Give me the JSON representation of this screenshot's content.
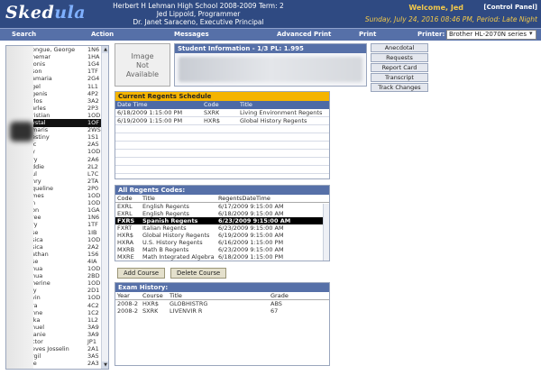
{
  "app": {
    "logo_main": "Sked",
    "logo_rest": "ula",
    "school_line1": "Herbert H Lehman High School 2008-2009 Term: 2",
    "school_line2": "Jed Lippold, Programmer",
    "school_line3": "Dr. Janet Saraceno, Executive Principal",
    "welcome": "Welcome, Jed",
    "control_panel": "[Control Panel]",
    "date_period": "Sunday, July 24, 2016 08:46 PM, Period: Late Night"
  },
  "menu": {
    "search": "Search",
    "action": "Action",
    "messages": "Messages",
    "advanced_print": "Advanced Print",
    "print": "Print",
    "printer_label": "Printer:",
    "printer_value": "Brother HL-2070N series"
  },
  "student_list": [
    {
      "name": "ongue, George",
      "code": "1N6"
    },
    {
      "name": "hemar",
      "code": "1HA"
    },
    {
      "name": "ionis",
      "code": "1G4"
    },
    {
      "name": "son",
      "code": "1TF"
    },
    {
      "name": "amaria",
      "code": "2G4"
    },
    {
      "name": "gel",
      "code": "1L1"
    },
    {
      "name": "genis",
      "code": "4P2"
    },
    {
      "name": "rlos",
      "code": "3A2"
    },
    {
      "name": "arles",
      "code": "2P3"
    },
    {
      "name": "ristian",
      "code": "1OD"
    },
    {
      "name": "ystal",
      "code": "1OF",
      "selected": true
    },
    {
      "name": "maris",
      "code": "2WS"
    },
    {
      "name": "estiny",
      "code": "1S1"
    },
    {
      "name": "ic",
      "code": "2A5"
    },
    {
      "name": "y",
      "code": "1OD"
    },
    {
      "name": "ry",
      "code": "2A6"
    },
    {
      "name": "ddie",
      "code": "2L2"
    },
    {
      "name": "ul",
      "code": "L7C"
    },
    {
      "name": "nry",
      "code": "2TA"
    },
    {
      "name": "queline",
      "code": "2P0"
    },
    {
      "name": "mes",
      "code": "1OD"
    },
    {
      "name": "n",
      "code": "1OD"
    },
    {
      "name": "on",
      "code": "1GA"
    },
    {
      "name": "ree",
      "code": "1N6"
    },
    {
      "name": "ry",
      "code": "1TF"
    },
    {
      "name": "se",
      "code": "1IB"
    },
    {
      "name": "sica",
      "code": "1OD"
    },
    {
      "name": "sica",
      "code": "2A2"
    },
    {
      "name": "athan",
      "code": "1S6"
    },
    {
      "name": "se",
      "code": "4IA"
    },
    {
      "name": "hua",
      "code": "1OD"
    },
    {
      "name": "hua",
      "code": "2BD"
    },
    {
      "name": "herine",
      "code": "1OD"
    },
    {
      "name": "ly",
      "code": "2D1"
    },
    {
      "name": "vin",
      "code": "1OD"
    },
    {
      "name": "ra",
      "code": "4C2"
    },
    {
      "name": "nne",
      "code": "1C2"
    },
    {
      "name": "ika",
      "code": "1L2"
    },
    {
      "name": "huel",
      "code": "3A9"
    },
    {
      "name": "lanie",
      "code": "3A9"
    },
    {
      "name": "ctor",
      "code": "JP1"
    },
    {
      "name": "eves Josselin",
      "code": "2A1"
    },
    {
      "name": "rgil",
      "code": "3A5"
    },
    {
      "name": "ie",
      "code": "2A3"
    }
  ],
  "photo": {
    "text_line1": "Image",
    "text_line2": "Not",
    "text_line3": "Available"
  },
  "student_info": {
    "title": "Student Information - 1/3 PL: 1.995"
  },
  "side_buttons": [
    "Anecdotal",
    "Requests",
    "Report Card",
    "Transcript",
    "Track Changes"
  ],
  "regents_schedule": {
    "title": "Current Regents Schedule",
    "headers": [
      "Date Time",
      "Code",
      "Title"
    ],
    "rows": [
      [
        "6/18/2009 1:15:00 PM",
        "SXRK",
        "Living Environment Regents"
      ],
      [
        "6/19/2009 1:15:00 PM",
        "HXR$",
        "Global History Regents"
      ]
    ]
  },
  "all_regents": {
    "title": "All Regents Codes:",
    "headers": [
      "Code",
      "Title",
      "RegentsDateTime"
    ],
    "rows": [
      [
        "EXRL",
        "English Regents",
        "6/17/2009 9:15:00 AM"
      ],
      [
        "EXRL",
        "English Regents",
        "6/18/2009 9:15:00 AM"
      ],
      [
        "FXRS",
        "Spanish Regents",
        "6/23/2009 9:15:00 AM"
      ],
      [
        "FXRT",
        "Italian Regents",
        "6/23/2009 9:15:00 AM"
      ],
      [
        "HXR$",
        "Global History Regents",
        "6/19/2009 9:15:00 AM"
      ],
      [
        "HXRA",
        "U.S. History Regents",
        "6/16/2009 1:15:00 PM"
      ],
      [
        "MXRB",
        "Math B Regents",
        "6/23/2009 9:15:00 AM"
      ],
      [
        "MXRE",
        "Math Integrated Algebra",
        "6/18/2009 1:15:00 PM"
      ]
    ],
    "selected_index": 2
  },
  "buttons": {
    "add_course": "Add Course",
    "delete_course": "Delete Course"
  },
  "exam_history": {
    "title": "Exam History:",
    "headers": [
      "Year",
      "Course",
      "Title",
      "Grade"
    ],
    "rows": [
      [
        "2008-2",
        "HXR$",
        "GLOBHISTRG",
        "ABS"
      ],
      [
        "2008-2",
        "SXRK",
        "LIVENVIR R",
        "67"
      ]
    ]
  }
}
